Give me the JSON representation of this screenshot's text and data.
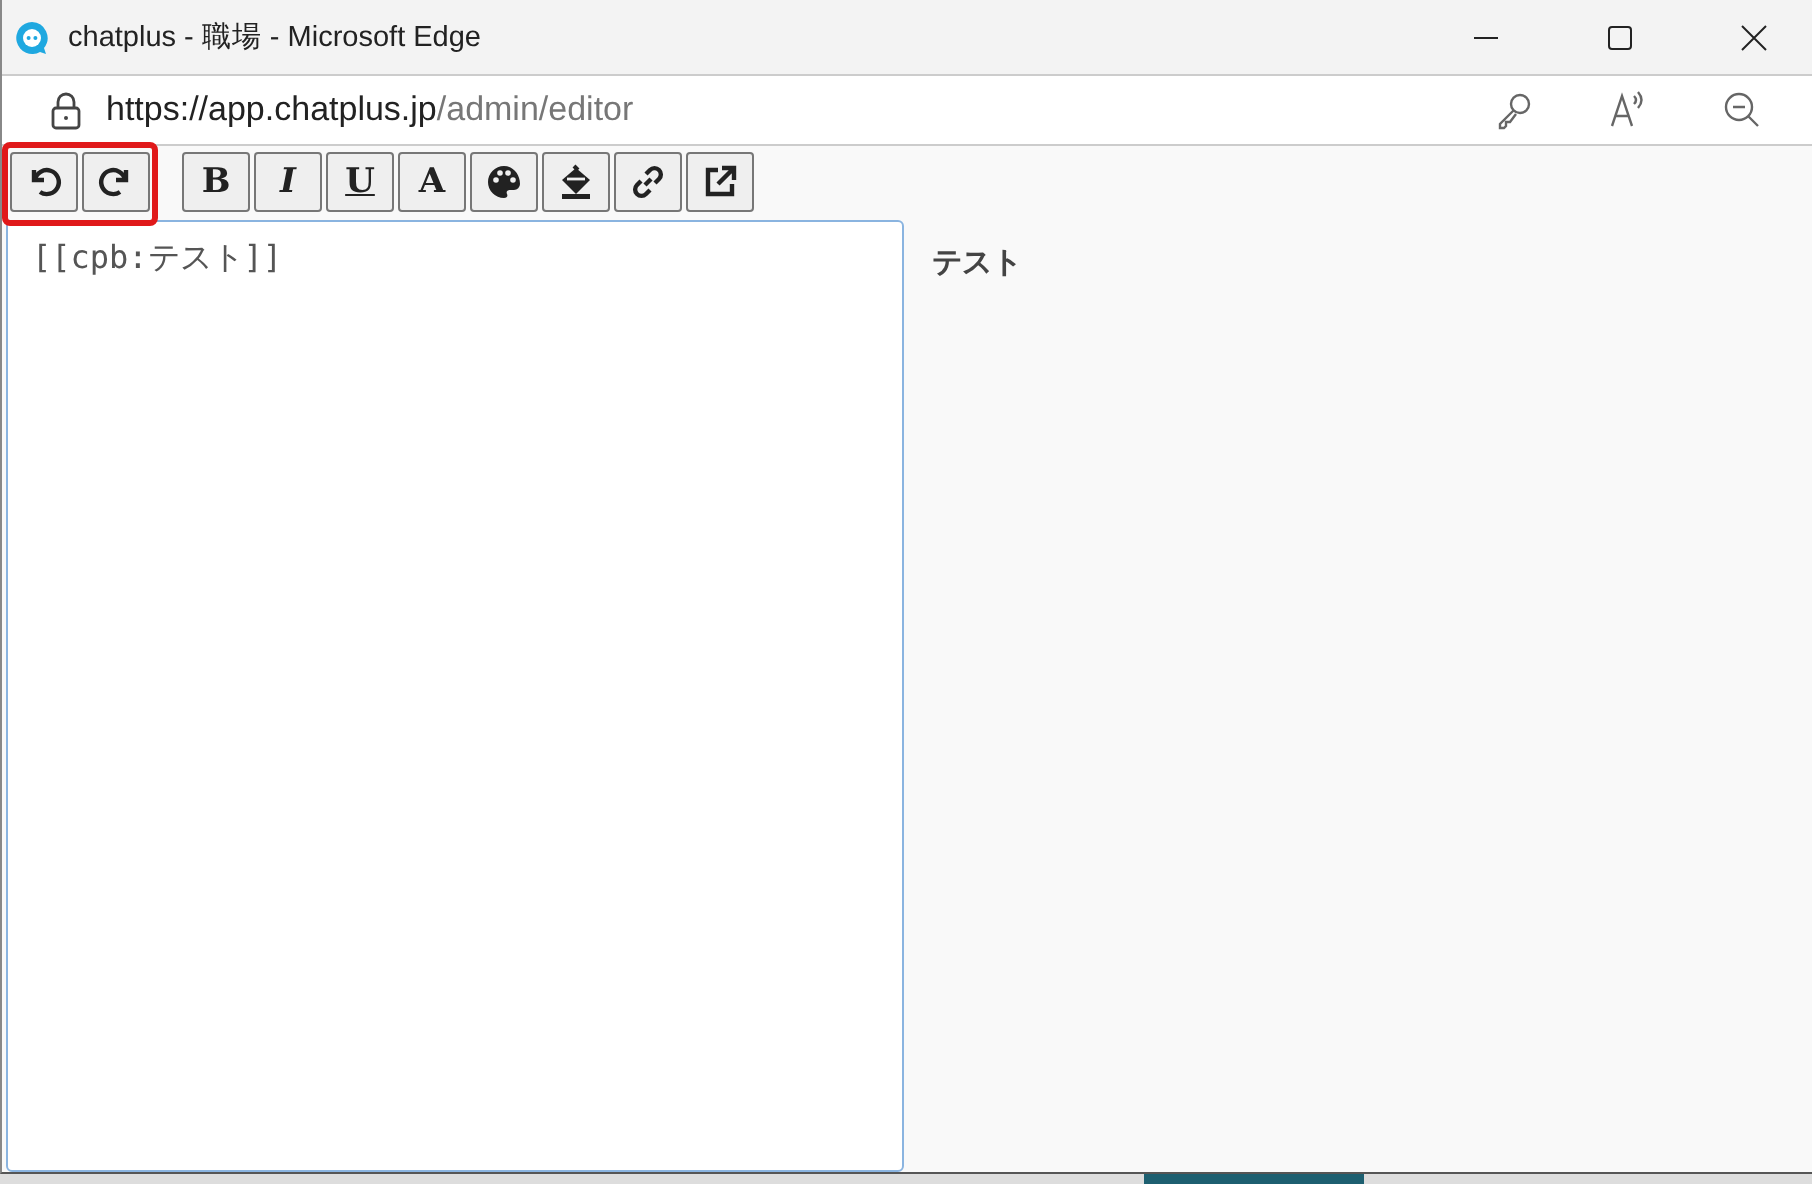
{
  "window": {
    "title": "chatplus - 職場 - Microsoft Edge"
  },
  "address_bar": {
    "host": "https://app.chatplus.jp",
    "path": "/admin/editor"
  },
  "toolbar": {
    "groups": [
      [
        {
          "kind": "undo",
          "highlighted": true
        },
        {
          "kind": "redo",
          "highlighted": true
        }
      ],
      [
        {
          "kind": "bold",
          "label": "B"
        },
        {
          "kind": "italic",
          "label": "I"
        },
        {
          "kind": "underline",
          "label": "U"
        },
        {
          "kind": "font-color",
          "label": "A"
        },
        {
          "kind": "palette"
        },
        {
          "kind": "fill"
        },
        {
          "kind": "link"
        },
        {
          "kind": "external"
        }
      ]
    ]
  },
  "editor": {
    "value": "[[cpb:テスト]]"
  },
  "preview": {
    "text": "テスト"
  }
}
